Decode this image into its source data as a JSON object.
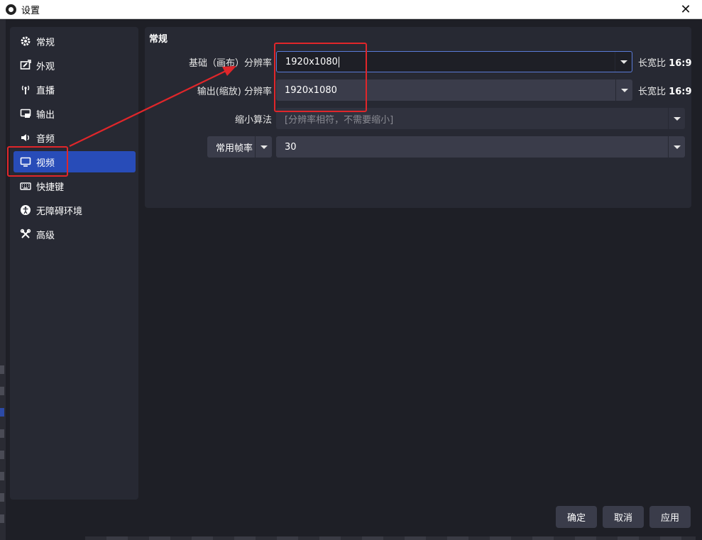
{
  "window": {
    "title": "设置",
    "close": "✕"
  },
  "sidebar": {
    "items": [
      {
        "label": "常规",
        "icon": "gear-icon"
      },
      {
        "label": "外观",
        "icon": "appearance-icon"
      },
      {
        "label": "直播",
        "icon": "antenna-icon"
      },
      {
        "label": "输出",
        "icon": "output-icon"
      },
      {
        "label": "音频",
        "icon": "speaker-icon"
      },
      {
        "label": "视频",
        "icon": "monitor-icon"
      },
      {
        "label": "快捷键",
        "icon": "keyboard-icon"
      },
      {
        "label": "无障碍环境",
        "icon": "accessibility-icon"
      },
      {
        "label": "高级",
        "icon": "tools-icon"
      }
    ],
    "active": "视频"
  },
  "video": {
    "section_title": "常规",
    "base_resolution": {
      "label": "基础（画布）分辨率",
      "value": "1920x1080",
      "aspect_label": "长宽比",
      "aspect_value": "16:9"
    },
    "output_resolution": {
      "label": "输出(缩放) 分辨率",
      "value": "1920x1080",
      "aspect_label": "长宽比",
      "aspect_value": "16:9"
    },
    "downscale": {
      "label": "缩小算法",
      "value": "[分辨率相符，不需要缩小]"
    },
    "fps": {
      "type_label": "常用帧率",
      "value": "30"
    }
  },
  "buttons": {
    "ok": "确定",
    "cancel": "取消",
    "apply": "应用"
  },
  "annotation_color": "#e0262a",
  "accent": "#284cb8"
}
